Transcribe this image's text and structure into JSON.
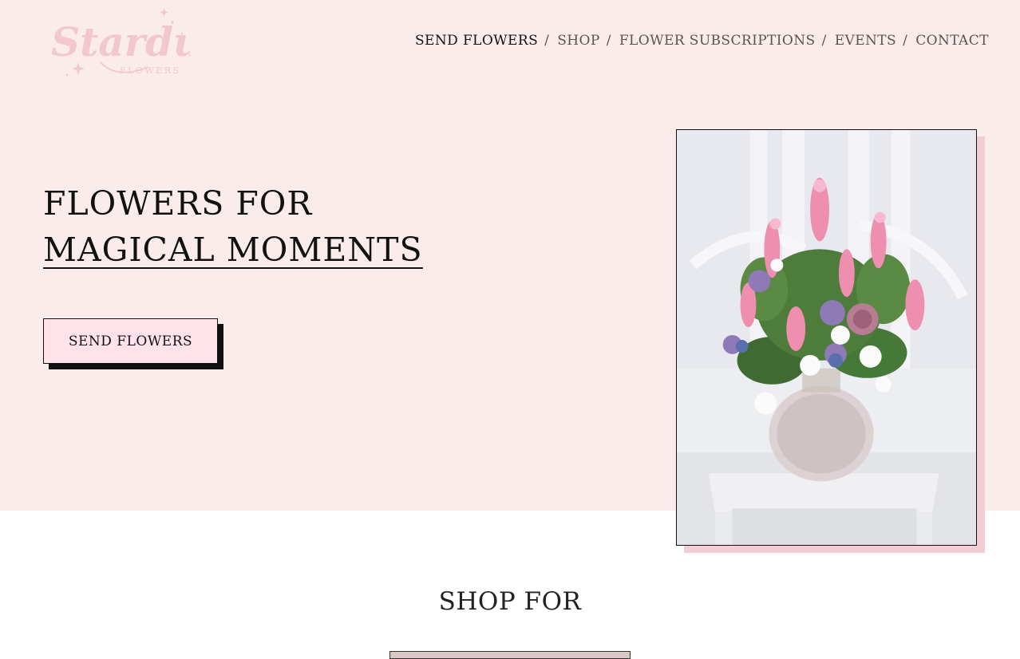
{
  "brand": {
    "logo_icon": "stardust-flowers-logo",
    "logo_text": "Stardust",
    "logo_sub": "FLOWERS",
    "color": "#f2c7d0"
  },
  "nav": {
    "items": [
      {
        "label": "SEND FLOWERS",
        "active": true
      },
      {
        "label": "SHOP",
        "active": false
      },
      {
        "label": "FLOWER SUBSCRIPTIONS",
        "active": false
      },
      {
        "label": "EVENTS",
        "active": false
      },
      {
        "label": "CONTACT",
        "active": false
      }
    ],
    "separator": "/"
  },
  "hero": {
    "title_line1": "FLOWERS FOR",
    "title_line2": "MAGICAL MOMENTS",
    "cta_label": "SEND FLOWERS",
    "image_icon": "flower-bouquet-photo"
  },
  "shop": {
    "heading": "SHOP FOR"
  },
  "colors": {
    "hero_bg": "#fbecec",
    "button_bg": "#ffe2ea",
    "accent_pink": "#f2cdd4"
  }
}
